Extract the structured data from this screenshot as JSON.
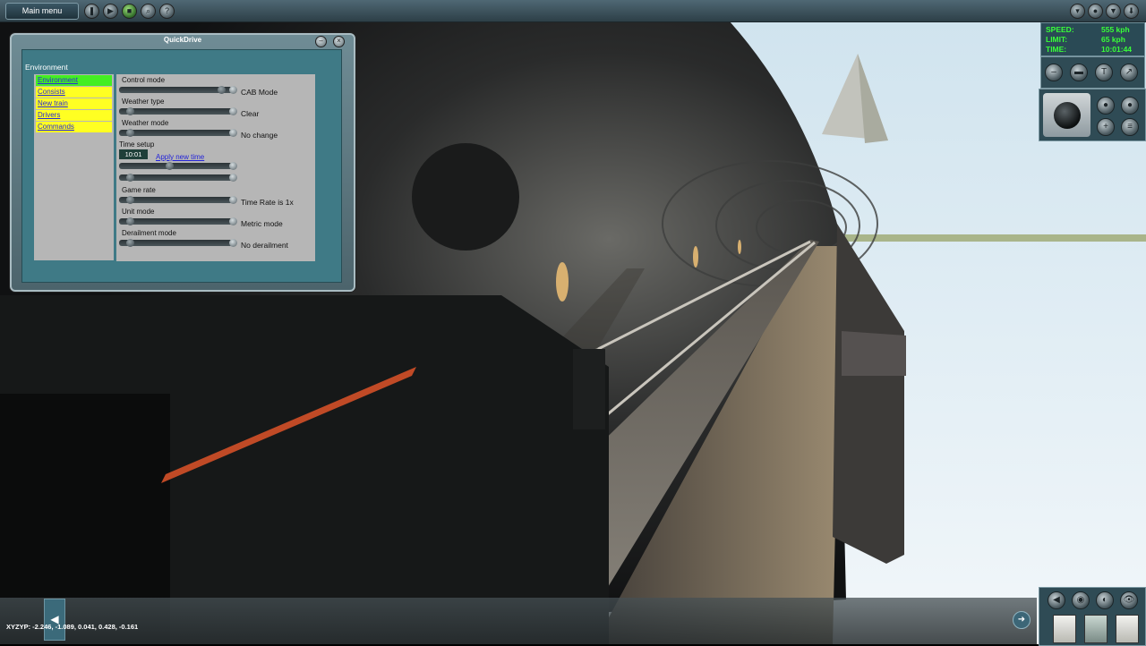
{
  "topbar": {
    "main_menu_label": "Main menu",
    "left_buttons": [
      "pause-icon",
      "play-icon",
      "stop-icon",
      "search-icon",
      "help-icon"
    ],
    "right_buttons": [
      "minimize-icon",
      "record-icon",
      "down-icon",
      "arrow-down-icon"
    ]
  },
  "quickdrive": {
    "title": "QuickDrive",
    "section": "Environment",
    "nav": [
      "Environment",
      "Consists",
      "New train",
      "Drivers",
      "Commands"
    ],
    "active_nav": "Environment",
    "options": {
      "control_mode": {
        "label": "Control mode",
        "value": "CAB Mode"
      },
      "weather_type": {
        "label": "Weather type",
        "value": "Clear"
      },
      "weather_mode": {
        "label": "Weather mode",
        "value": "No change"
      },
      "time_setup": {
        "label": "Time setup",
        "time_value": "10:01",
        "apply_link": "Apply new time"
      },
      "game_rate": {
        "label": "Game rate",
        "value": "Time Rate is 1x"
      },
      "unit_mode": {
        "label": "Unit mode",
        "value": "Metric mode"
      },
      "derailment_mode": {
        "label": "Derailment mode",
        "value": "No derailment"
      }
    }
  },
  "hud": {
    "speed_label": "SPEED:",
    "speed_value": "555 kph",
    "limit_label": "LIMIT:",
    "limit_value": "65 kph",
    "time_label": "TIME:",
    "time_value": "10:01:44"
  },
  "status": {
    "coords": "XYZYP: -2.246, -1.089, 0.041, 0.428, -0.161"
  },
  "colors": {
    "hud_text": "#39ff39",
    "nav_active": "#44ee22",
    "nav_item": "#ffff22",
    "panel": "#3f7a86",
    "sky": "#dfeef5"
  }
}
